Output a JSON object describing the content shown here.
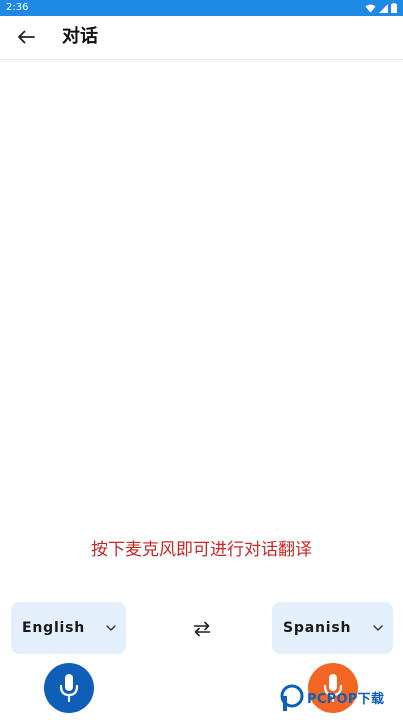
{
  "colors": {
    "status_bar": "#1e88e5",
    "hint_text": "#c62828",
    "lang_box_bg": "#e3f0fc",
    "mic_left": "#0d5fb8",
    "mic_right": "#f26522"
  },
  "status_bar": {
    "time": "2:36",
    "icons": [
      "wifi-icon",
      "signal-icon",
      "battery-icon"
    ]
  },
  "app_bar": {
    "back_icon": "arrow-left-icon",
    "title": "对话"
  },
  "conversation": {
    "hint": "按下麦克风即可进行对话翻译"
  },
  "languages": {
    "source": "English",
    "target": "Spanish",
    "dropdown_icon": "chevron-down-icon",
    "swap_icon": "swap-arrows-icon"
  },
  "mics": {
    "left_icon": "microphone-icon",
    "right_icon": "microphone-icon"
  },
  "watermark": {
    "text": "PCPOP下载"
  }
}
